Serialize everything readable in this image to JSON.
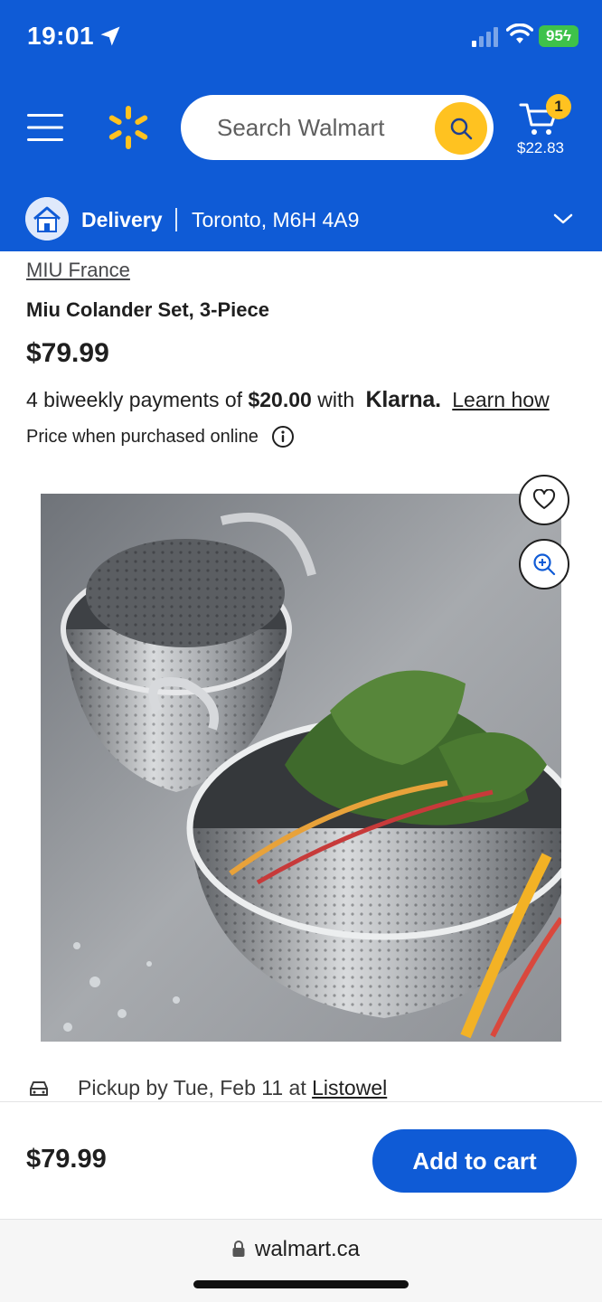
{
  "status_bar": {
    "time": "19:01",
    "battery": "95"
  },
  "header": {
    "search_placeholder": "Search Walmart",
    "cart_count": "1",
    "cart_total": "$22.83",
    "delivery_label": "Delivery",
    "delivery_location": "Toronto, M6H 4A9"
  },
  "product": {
    "brand": "MIU France",
    "title": "Miu Colander Set, 3-Piece",
    "price": "$79.99",
    "klarna_prefix": "4 biweekly payments of",
    "klarna_amount": "$20.00",
    "klarna_with": "with",
    "klarna_logo": "Klarna.",
    "learn_how": "Learn how",
    "price_note": "Price when purchased online"
  },
  "pickup": {
    "text": "Pickup by Tue, Feb 11 at",
    "store": "Listowel"
  },
  "bottom": {
    "price": "$79.99",
    "add_to_cart": "Add to cart"
  },
  "browser": {
    "url": "walmart.ca"
  },
  "colors": {
    "brand_blue": "#0f5bd6",
    "spark_yellow": "#ffc220",
    "battery_green": "#3ec24a"
  },
  "icons": [
    "location-arrow-icon",
    "signal-icon",
    "wifi-icon",
    "menu-icon",
    "walmart-spark-icon",
    "search-icon",
    "cart-icon",
    "house-icon",
    "chevron-down-icon",
    "info-icon",
    "heart-icon",
    "zoom-in-icon",
    "car-icon",
    "lock-icon"
  ]
}
